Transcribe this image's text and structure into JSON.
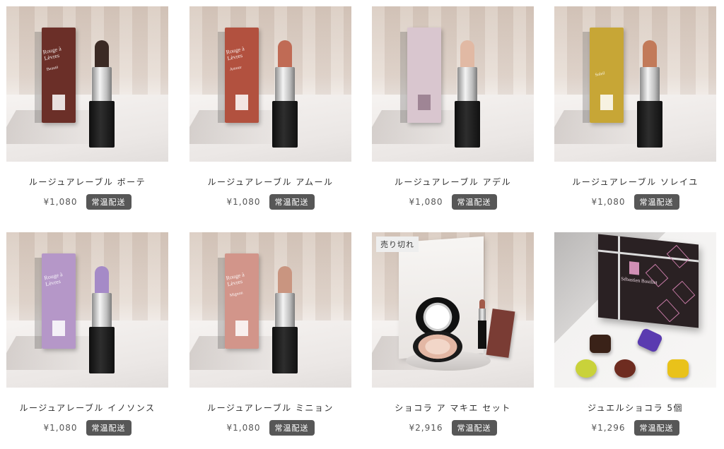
{
  "colors": {
    "badge_bg": "#575757",
    "badge_text": "#ffffff",
    "name_text": "#2d2d2d",
    "price_text": "#555555"
  },
  "products": [
    {
      "name": "ルージュアレーブル ボーテ",
      "price": "¥1,080",
      "badge": "常温配送",
      "box_text": "Rouge à Lèvres",
      "box_sub": "Beauté",
      "color_box": "#6b2f28",
      "color_bullet": "#3b2a24"
    },
    {
      "name": "ルージュアレーブル アムール",
      "price": "¥1,080",
      "badge": "常温配送",
      "box_text": "Rouge à Lèvres",
      "box_sub": "Amour",
      "color_box": "#b2513f",
      "color_bullet": "#c06b55"
    },
    {
      "name": "ルージュアレーブル アデル",
      "price": "¥1,080",
      "badge": "常温配送",
      "box_text": "",
      "box_sub": "",
      "color_box": "#d9c6cf",
      "color_bullet": "#e1b9a4"
    },
    {
      "name": "ルージュアレーブル ソレイユ",
      "price": "¥1,080",
      "badge": "常温配送",
      "box_text": "",
      "box_sub": "Soleil",
      "color_box": "#c7a636",
      "color_bullet": "#c27a59"
    },
    {
      "name": "ルージュアレーブル イノソンス",
      "price": "¥1,080",
      "badge": "常温配送",
      "box_text": "Rouge à Lèvres",
      "box_sub": "",
      "color_box": "#b597c8",
      "color_bullet": "#a58ac7"
    },
    {
      "name": "ルージュアレーブル ミニョン",
      "price": "¥1,080",
      "badge": "常温配送",
      "box_text": "Rouge à Lèvres",
      "box_sub": "Mignon",
      "color_box": "#d2958a",
      "color_bullet": "#c99580"
    },
    {
      "name": "ショコラ ア マキエ セット",
      "price": "¥2,916",
      "badge": "常温配送",
      "status": "売り切れ"
    },
    {
      "name": "ジュエルショコラ 5個",
      "price": "¥1,296",
      "badge": "常温配送",
      "box_logo_text": "Sébastien Bouillet"
    }
  ]
}
